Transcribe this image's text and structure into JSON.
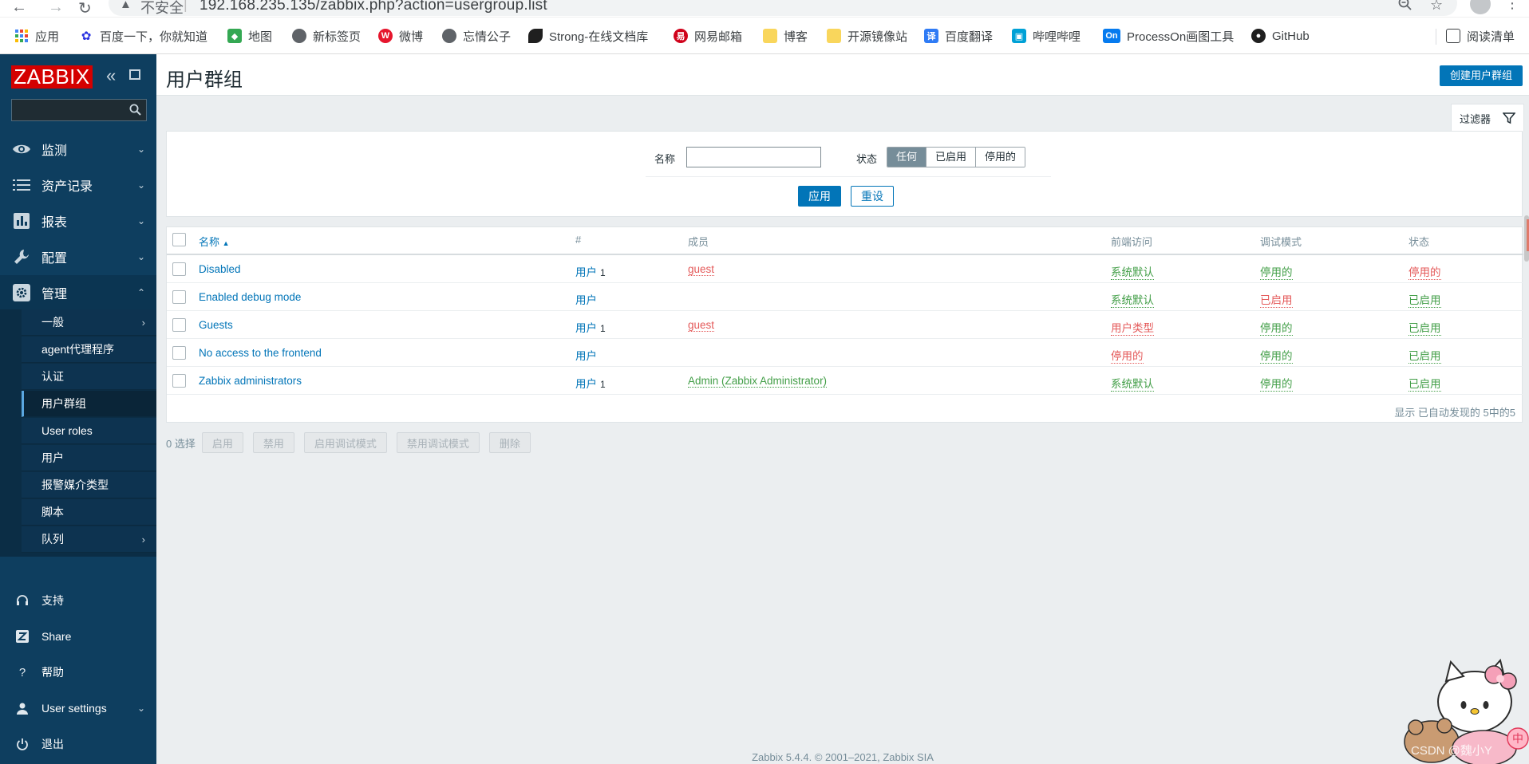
{
  "browser": {
    "insecure_label": "不安全",
    "url": "192.168.235.135/zabbix.php?action=usergroup.list",
    "bookmarks": [
      {
        "label": "应用",
        "icon": "apps-grid-icon",
        "color": "#4285f4"
      },
      {
        "label": "百度一下，你就知道",
        "icon": "baidu-paw-icon",
        "color": "#2932e1"
      },
      {
        "label": "地图",
        "icon": "maps-pin-icon",
        "color": "#34a853"
      },
      {
        "label": "新标签页",
        "icon": "globe-icon",
        "color": "#5f6368"
      },
      {
        "label": "微博",
        "icon": "weibo-icon",
        "color": "#e6162d"
      },
      {
        "label": "忘情公子",
        "icon": "globe-icon",
        "color": "#5f6368"
      },
      {
        "label": "Strong-在线文档库",
        "icon": "strong-leaf-icon",
        "color": "#1f1f1f"
      },
      {
        "label": "网易邮箱",
        "icon": "netease-mail-icon",
        "color": "#d0021b"
      },
      {
        "label": "博客",
        "icon": "folder-icon",
        "color": "#f9d65c"
      },
      {
        "label": "开源镜像站",
        "icon": "folder-icon",
        "color": "#f9d65c"
      },
      {
        "label": "百度翻译",
        "icon": "baidu-translate-icon",
        "color": "#2f7bf5"
      },
      {
        "label": "哔哩哔哩",
        "icon": "bilibili-icon",
        "color": "#00a1d6"
      },
      {
        "label": "ProcessOn画图工具",
        "icon": "processon-icon",
        "color": "#067bef"
      },
      {
        "label": "GitHub",
        "icon": "github-icon",
        "color": "#1f1f1f"
      }
    ],
    "reading_list": "阅读清单"
  },
  "sidebar": {
    "logo": "ZABBIX",
    "main_menu": [
      {
        "label": "监测",
        "icon": "eye-icon"
      },
      {
        "label": "资产记录",
        "icon": "list-icon"
      },
      {
        "label": "报表",
        "icon": "bar-chart-icon"
      },
      {
        "label": "配置",
        "icon": "wrench-icon"
      },
      {
        "label": "管理",
        "icon": "gear-icon"
      }
    ],
    "submenu": [
      {
        "label": "一般",
        "has_arrow": true
      },
      {
        "label": "agent代理程序",
        "has_arrow": false
      },
      {
        "label": "认证",
        "has_arrow": false
      },
      {
        "label": "用户群组",
        "has_arrow": false,
        "active": true
      },
      {
        "label": "User roles",
        "has_arrow": false
      },
      {
        "label": "用户",
        "has_arrow": false
      },
      {
        "label": "报警媒介类型",
        "has_arrow": false
      },
      {
        "label": "脚本",
        "has_arrow": false
      },
      {
        "label": "队列",
        "has_arrow": true
      }
    ],
    "bottom_menu": [
      {
        "label": "支持",
        "icon": "headset-icon"
      },
      {
        "label": "Share",
        "icon": "share-z-icon"
      },
      {
        "label": "帮助",
        "icon": "help-icon"
      },
      {
        "label": "User settings",
        "icon": "user-icon"
      },
      {
        "label": "退出",
        "icon": "power-icon"
      }
    ]
  },
  "header": {
    "title": "用户群组",
    "create_button": "创建用户群组"
  },
  "filter": {
    "tab_label": "过滤器",
    "name_label": "名称",
    "name_value": "",
    "status_label": "状态",
    "status_options": [
      "任何",
      "已启用",
      "停用的"
    ],
    "status_selected": "任何",
    "apply": "应用",
    "reset": "重设"
  },
  "table": {
    "columns": {
      "name": "名称",
      "count": "#",
      "members": "成员",
      "frontend": "前端访问",
      "debug": "调试模式",
      "status": "状态"
    },
    "rows": [
      {
        "name": "Disabled",
        "users_label": "用户",
        "users_count": "1",
        "members": "guest",
        "members_color": "red",
        "frontend": "系统默认",
        "frontend_color": "green",
        "debug": "停用的",
        "debug_color": "green",
        "status": "停用的",
        "status_color": "red"
      },
      {
        "name": "Enabled debug mode",
        "users_label": "用户",
        "users_count": "",
        "members": "",
        "members_color": "",
        "frontend": "系统默认",
        "frontend_color": "green",
        "debug": "已启用",
        "debug_color": "red",
        "status": "已启用",
        "status_color": "green"
      },
      {
        "name": "Guests",
        "users_label": "用户",
        "users_count": "1",
        "members": "guest",
        "members_color": "red",
        "frontend": "用户类型",
        "frontend_color": "red",
        "debug": "停用的",
        "debug_color": "green",
        "status": "已启用",
        "status_color": "green"
      },
      {
        "name": "No access to the frontend",
        "users_label": "用户",
        "users_count": "",
        "members": "",
        "members_color": "",
        "frontend": "停用的",
        "frontend_color": "red",
        "debug": "停用的",
        "debug_color": "green",
        "status": "已启用",
        "status_color": "green"
      },
      {
        "name": "Zabbix administrators",
        "users_label": "用户",
        "users_count": "1",
        "members": "Admin (Zabbix Administrator)",
        "members_color": "green",
        "frontend": "系统默认",
        "frontend_color": "green",
        "debug": "停用的",
        "debug_color": "green",
        "status": "已启用",
        "status_color": "green"
      }
    ],
    "paging": "显示 已自动发现的 5中的5"
  },
  "actions": {
    "selected": "0 选择",
    "buttons": [
      "启用",
      "禁用",
      "启用调试模式",
      "禁用调试模式",
      "删除"
    ]
  },
  "footer": "Zabbix 5.4.4. © 2001–2021, Zabbix SIA",
  "watermark": "CSDN @魏小Y",
  "colors": {
    "sidebar_bg": "#0e3e5f",
    "logo_red": "#d40000",
    "primary_blue": "#0275b8",
    "status_green": "#429e47",
    "status_red": "#e45959"
  }
}
